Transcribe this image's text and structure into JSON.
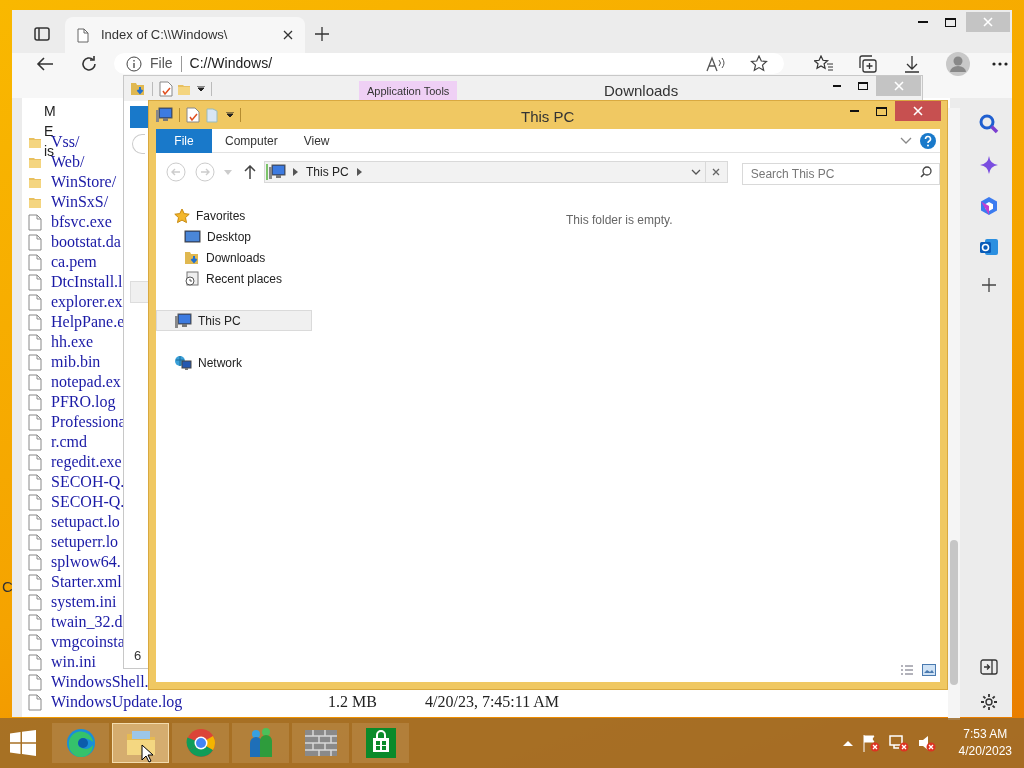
{
  "browser": {
    "tab_title": "Index of C:\\\\Windows\\",
    "address_scheme": "File",
    "address": "C://Windows/",
    "page_header_fragments": [
      "M",
      "E",
      "is"
    ],
    "files": [
      {
        "name": "Vss/",
        "kind": "folder"
      },
      {
        "name": "Web/",
        "kind": "folder"
      },
      {
        "name": "WinStore/",
        "kind": "folder"
      },
      {
        "name": "WinSxS/",
        "kind": "folder"
      },
      {
        "name": "bfsvc.exe",
        "kind": "file"
      },
      {
        "name": "bootstat.da",
        "kind": "file"
      },
      {
        "name": "ca.pem",
        "kind": "file"
      },
      {
        "name": "DtcInstall.l",
        "kind": "file"
      },
      {
        "name": "explorer.ex",
        "kind": "file"
      },
      {
        "name": "HelpPane.e",
        "kind": "file"
      },
      {
        "name": "hh.exe",
        "kind": "file"
      },
      {
        "name": "mib.bin",
        "kind": "file"
      },
      {
        "name": "notepad.ex",
        "kind": "file"
      },
      {
        "name": "PFRO.log",
        "kind": "file"
      },
      {
        "name": "Professiona",
        "kind": "file"
      },
      {
        "name": "r.cmd",
        "kind": "file"
      },
      {
        "name": "regedit.exe",
        "kind": "file"
      },
      {
        "name": "SECOH-Q.",
        "kind": "file"
      },
      {
        "name": "SECOH-Q.",
        "kind": "file"
      },
      {
        "name": "setupact.lo",
        "kind": "file"
      },
      {
        "name": "setuperr.lo",
        "kind": "file"
      },
      {
        "name": "splwow64.",
        "kind": "file"
      },
      {
        "name": "Starter.xml",
        "kind": "file"
      },
      {
        "name": "system.ini",
        "kind": "file"
      },
      {
        "name": "twain_32.d",
        "kind": "file"
      },
      {
        "name": "vmgcoinsta",
        "kind": "file"
      },
      {
        "name": "win.ini",
        "kind": "file"
      },
      {
        "name": "WindowsShell.",
        "kind": "file"
      },
      {
        "name": "WindowsUpdate.log",
        "kind": "file",
        "size": "1.2 MB",
        "modified": "4/20/23, 7:45:11 AM"
      }
    ]
  },
  "downloads_window": {
    "title": "Downloads",
    "contextual_tab": "Application Tools",
    "partial_text": "6"
  },
  "explorer": {
    "title": "This PC",
    "ribbon_tabs": [
      {
        "label": "File",
        "selected": true
      },
      {
        "label": "Computer",
        "selected": false
      },
      {
        "label": "View",
        "selected": false
      }
    ],
    "breadcrumb": [
      "This PC"
    ],
    "search": {
      "placeholder": "Search This PC"
    },
    "nav": [
      {
        "label": "Favorites",
        "kind": "star",
        "selected": false,
        "children": [
          {
            "label": "Desktop",
            "kind": "desktop",
            "selected": false
          },
          {
            "label": "Downloads",
            "kind": "downloads",
            "selected": false
          },
          {
            "label": "Recent places",
            "kind": "recent",
            "selected": false
          }
        ]
      },
      {
        "label": "This PC",
        "kind": "pc",
        "selected": true
      },
      {
        "label": "Network",
        "kind": "network",
        "selected": false
      }
    ],
    "empty_message": "This folder is empty."
  },
  "desktop_partial_text": "C",
  "taskbar": {
    "apps": [
      {
        "kind": "edge",
        "selected": false
      },
      {
        "kind": "explorer",
        "selected": true
      },
      {
        "kind": "chrome",
        "selected": false
      },
      {
        "kind": "people",
        "selected": false
      },
      {
        "kind": "firewall",
        "selected": false
      },
      {
        "kind": "store",
        "selected": false
      }
    ],
    "clock": {
      "time": "7:53 AM",
      "date": "4/20/2023"
    }
  }
}
